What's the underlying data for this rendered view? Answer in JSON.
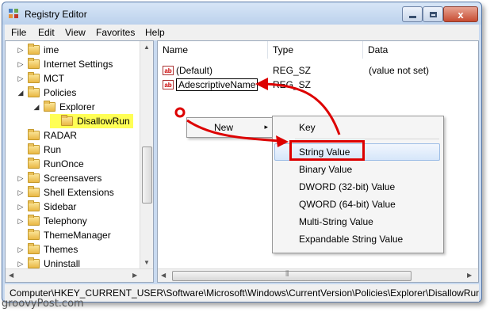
{
  "window": {
    "title": "Registry Editor",
    "close_glyph": "x",
    "icon": "regedit-icon"
  },
  "menu": [
    "File",
    "Edit",
    "View",
    "Favorites",
    "Help"
  ],
  "tree": {
    "items": [
      {
        "label": "ime",
        "expander": "▷"
      },
      {
        "label": "Internet Settings",
        "expander": "▷"
      },
      {
        "label": "MCT",
        "expander": "▷"
      },
      {
        "label": "Policies",
        "expander": "◢"
      },
      {
        "label": "Explorer",
        "expander": "◢"
      },
      {
        "label": "DisallowRun",
        "expander": ""
      },
      {
        "label": "RADAR",
        "expander": ""
      },
      {
        "label": "Run",
        "expander": ""
      },
      {
        "label": "RunOnce",
        "expander": ""
      },
      {
        "label": "Screensavers",
        "expander": "▷"
      },
      {
        "label": "Shell Extensions",
        "expander": "▷"
      },
      {
        "label": "Sidebar",
        "expander": "▷"
      },
      {
        "label": "Telephony",
        "expander": "▷"
      },
      {
        "label": "ThemeManager",
        "expander": ""
      },
      {
        "label": "Themes",
        "expander": "▷"
      },
      {
        "label": "Uninstall",
        "expander": "▷"
      }
    ]
  },
  "values": {
    "columns": [
      "Name",
      "Type",
      "Data"
    ],
    "rows": [
      {
        "name": "(Default)",
        "type": "REG_SZ",
        "data": "(value not set)"
      },
      {
        "name": "AdescriptiveName",
        "type": "REG_SZ",
        "data": ""
      }
    ]
  },
  "context_menu": {
    "new_label": "New",
    "arrow": "▸"
  },
  "submenu": {
    "items": [
      "Key",
      "String Value",
      "Binary Value",
      "DWORD (32-bit) Value",
      "QWORD (64-bit) Value",
      "Multi-String Value",
      "Expandable String Value"
    ],
    "highlighted": "String Value"
  },
  "scroll_glyphs": {
    "up": "▲",
    "down": "▼",
    "left": "◀",
    "right": "▶",
    "grip": "⦀"
  },
  "status": {
    "path": "Computer\\HKEY_CURRENT_USER\\Software\\Microsoft\\Windows\\CurrentVersion\\Policies\\Explorer\\DisallowRun"
  },
  "watermark": "groovyPost.com",
  "colors": {
    "annotation": "#dd0000",
    "selection_highlight": "#ffff55"
  }
}
